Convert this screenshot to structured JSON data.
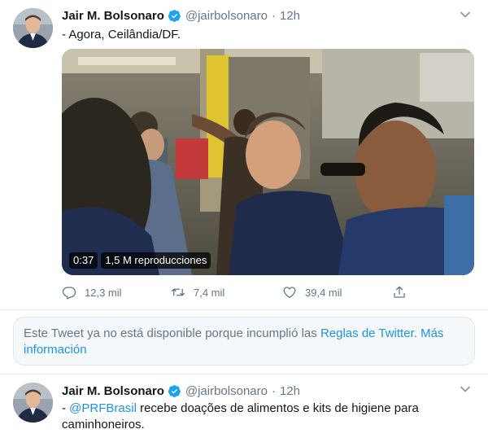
{
  "colors": {
    "link_blue": "#1b95e0",
    "secondary_text": "#657786",
    "verified_blue": "#1da1f2",
    "notice_bg": "#f5f8fa"
  },
  "tweets": [
    {
      "display_name": "Jair M. Bolsonaro",
      "handle": "@jairbolsonaro",
      "dot": "·",
      "time": "12h",
      "verified": true,
      "text": "- Agora, Ceilândia/DF.",
      "video": {
        "duration": "0:37",
        "views": "1,5 M reproducciones"
      },
      "actions": {
        "reply_count": "12,3 mil",
        "retweet_count": "7,4 mil",
        "like_count": "39,4 mil"
      },
      "icons": [
        "verified-badge-icon",
        "chevron-down-icon",
        "reply-icon",
        "retweet-icon",
        "heart-icon",
        "share-icon"
      ]
    },
    {
      "display_name": "Jair M. Bolsonaro",
      "handle": "@jairbolsonaro",
      "dot": "·",
      "time": "12h",
      "verified": true,
      "text_prefix": "- ",
      "mention": "@PRFBrasil",
      "text_rest": " recebe doações de alimentos e kits de higiene para caminhoneiros.",
      "icons": [
        "verified-badge-icon",
        "chevron-down-icon"
      ]
    }
  ],
  "notice": {
    "text": "Este Tweet ya no está disponible porque incumplió las ",
    "rules_link": "Reglas de Twitter",
    "separator": ". ",
    "more_link": "Más información"
  }
}
